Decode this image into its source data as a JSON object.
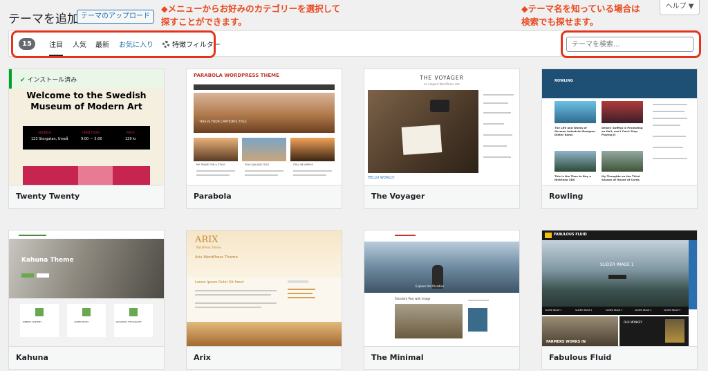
{
  "header": {
    "title": "テーマを追加",
    "upload_button": "テーマのアップロード",
    "help_button": "ヘルプ ▼"
  },
  "annotations": {
    "left": [
      "◆メニューからお好みのカテゴリーを選択して",
      "探すことができます。"
    ],
    "right": [
      "◆テーマ名を知っている場合は",
      "検索でも探せます。"
    ]
  },
  "filter": {
    "count": "15",
    "tabs": [
      "注目",
      "人気",
      "最新",
      "お気に入り"
    ],
    "feature_filter": "特徴フィルター",
    "search_placeholder": "テーマを検索..."
  },
  "colors": {
    "accent": "#2271b1",
    "annotation": "#e8491d",
    "highlight": "#e4331b",
    "installed": "#00a32a"
  },
  "themes": [
    {
      "name": "Twenty Twenty",
      "installed": "インストール済み",
      "heading": [
        "Welcome to the Swedish",
        "Museum of Modern Art"
      ],
      "info": [
        "ADDRESS",
        "123 Storgatan, Umeå",
        "OPEN TODAY",
        "9:00 — 5:00",
        "PRICE",
        "129 kr"
      ]
    },
    {
      "name": "Parabola",
      "logo": "PARABOLA WORDPRESS THEME",
      "caption": "THIS IS YOUR CAPTION'S TITLE",
      "posts": [
        "MY TRADE FOR A STYLE",
        "YOU CAN ADD TITLE",
        "STILL BE SIMPLE"
      ]
    },
    {
      "name": "The Voyager",
      "logo": "THE VOYAGER",
      "tagline": "an elegant WordPress site",
      "post": "HELLO WORLD!"
    },
    {
      "name": "Rowling",
      "logo": "ROWLING",
      "posts": [
        "The Life and Works of German Industrial Designer Dieter Rams",
        "Dewey Goffing is Promoting on Hell, and I Can't Stop Playing it",
        "This is the Time to Buy a Nintendo 3DS",
        "My Thoughts on the Third Season of House of Cards"
      ]
    },
    {
      "name": "Kahuna",
      "hero": "Kahuna Theme",
      "features": [
        "RIBBON CONTENT",
        "LOREM IPSUM",
        "ADVANCED TYPOGRAPHY"
      ]
    },
    {
      "name": "Arix",
      "logo": "ARIX",
      "subtitle": "WordPress Theme",
      "hero": "Arix WordPress Theme",
      "post": "Lorem Ipsum Dolor Sit Amet"
    },
    {
      "name": "The Minimal",
      "hero": "Explore the Paradise",
      "post": "Standard Post with image"
    },
    {
      "name": "Fabulous Fluid",
      "logo": "FABULOUS FLUID",
      "slider": "SLIDER IMAGE 1",
      "tabs": [
        "SLIDER IMAGE 1",
        "SLIDER IMAGE 2",
        "SLIDER IMAGE 3",
        "SLIDER IMAGE 4",
        "SLIDER IMAGE 5"
      ],
      "caption": "FARMERS WORKS IN",
      "side": "OLD MONKEY"
    }
  ]
}
